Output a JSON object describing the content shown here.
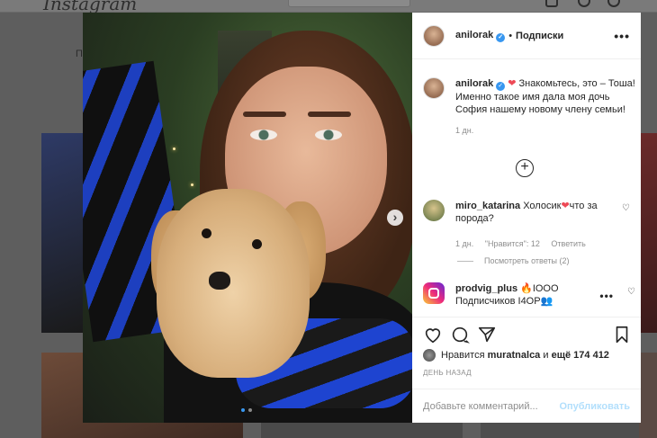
{
  "background": {
    "logo": "Instagram",
    "left_text": "П"
  },
  "post": {
    "username": "anilorak",
    "follow_label": "Подписки",
    "caption_user": "anilorak",
    "caption_text": "Знакомьтесь, это – Тоша! Именно такое имя дала моя дочь София нашему новому члену семьи!",
    "caption_time": "1 дн.",
    "comments": [
      {
        "user": "miro_katarina",
        "text_before": "Холосик",
        "text_after": "что за порода?",
        "time": "1 дн.",
        "likes": "\"Нравится\": 12",
        "reply": "Ответить"
      },
      {
        "user": "prodvig_plus",
        "text": "🔥IOOO Подписчиков I4OP👥"
      }
    ],
    "view_replies": "Посмотреть ответы (2)",
    "likes_prefix": "Нравится",
    "likes_user": "muratnalca",
    "likes_suffix": "и",
    "likes_more": "ещё 174 412",
    "date": "ДЕНЬ НАЗАД",
    "comment_placeholder": "Добавьте комментарий...",
    "publish_label": "Опубликовать"
  },
  "colors": {
    "verified": "#3897f0",
    "heart": "#ed4956",
    "publish_disabled": "#b2dffc"
  }
}
